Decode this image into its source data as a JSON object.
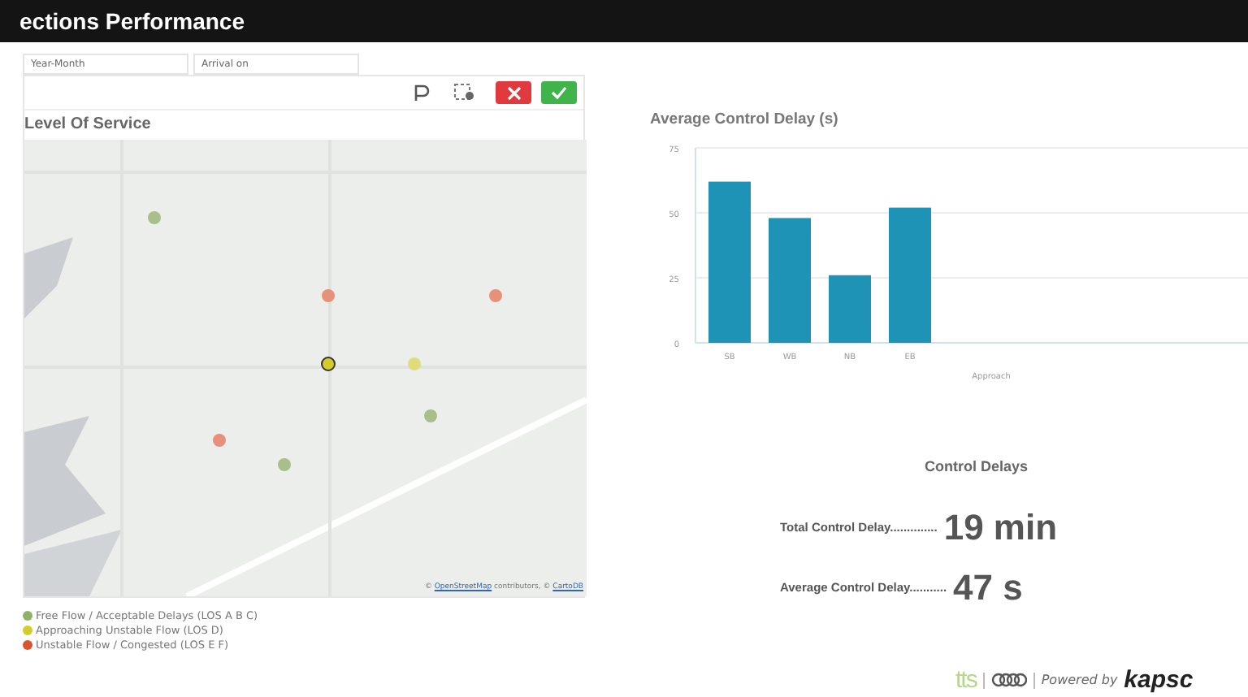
{
  "header": {
    "title": "ections Performance"
  },
  "filters": [
    {
      "label": "Year-Month"
    },
    {
      "label": "Arrival on"
    }
  ],
  "map_panel": {
    "title": "Level Of Service",
    "attribution_prefix": "© ",
    "attribution_link_1": "OpenStreetMap",
    "attribution_middle": " contributors, © ",
    "attribution_link_2": "CartoDB",
    "legend": [
      {
        "label": "Free Flow / Acceptable Delays (LOS A B C)",
        "color": "#8db36a"
      },
      {
        "label": "Approaching Unstable Flow (LOS D)",
        "color": "#d4cc2a"
      },
      {
        "label": "Unstable Flow / Congested (LOS E F)",
        "color": "#d9542c"
      }
    ]
  },
  "chart_panel": {
    "chart_data": {
      "type": "bar",
      "title": "Average Control Delay (s)",
      "xlabel": "Approach",
      "categories": [
        "SB",
        "WB",
        "NB",
        "EB"
      ],
      "series": [
        {
          "color": "#1f93b5",
          "values": [
            62,
            48,
            26,
            52
          ]
        }
      ],
      "ylim": [
        0,
        75
      ],
      "yticks": [
        0,
        25,
        50,
        75
      ]
    }
  },
  "control_delays": {
    "title": "Control Delays",
    "rows": [
      {
        "label": "Total Control Delay",
        "leader": "..............",
        "value": "19 min"
      },
      {
        "label": "Average Control Delay",
        "leader": "...........",
        "value": "47 s"
      }
    ]
  },
  "footer": {
    "logo_text": "tts",
    "powered_by": "Powered by",
    "brand": "kapsc"
  }
}
